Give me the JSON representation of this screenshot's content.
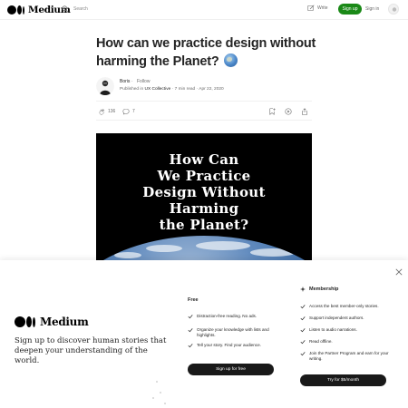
{
  "topbar": {
    "logo_text": "Medium",
    "search_placeholder": "Search",
    "write_label": "Write",
    "signup_label": "Sign up",
    "signin_label": "Sign in"
  },
  "article": {
    "title": "How can we practice design without harming the Planet?",
    "author": {
      "name": "Boris",
      "separator": "·",
      "follow": "Follow",
      "published_in_prefix": "Published in",
      "publication": "UX Collective",
      "read_time": "7 min read",
      "date": "Apr 22, 2020"
    },
    "claps": "136",
    "responses": "7",
    "hero_text_lines": [
      "How Can",
      "We Practice",
      "Design Without",
      "Harming",
      "the Planet?"
    ]
  },
  "modal": {
    "logo_text": "Medium",
    "tagline": "Sign up to discover human stories that deepen your understanding of the world.",
    "free": {
      "title": "Free",
      "items": [
        "Distraction-free reading. No ads.",
        "Organize your knowledge with lists and highlights.",
        "Tell your story. Find your audience."
      ],
      "cta": "Sign up for free"
    },
    "membership": {
      "title": "Membership",
      "items": [
        "Access the best member-only stories.",
        "Support independent authors.",
        "Listen to audio narrations.",
        "Read offline.",
        "Join the Partner Program and earn for your writing."
      ],
      "cta": "Try for $5/month"
    }
  },
  "colors": {
    "brand_green": "#1a8917",
    "text_primary": "#242424",
    "text_secondary": "#6b6b6b",
    "cta_dark": "#191919"
  },
  "icons": [
    "search-icon",
    "write-icon",
    "clap-icon",
    "comment-icon",
    "bookmark-add-icon",
    "play-icon",
    "share-icon",
    "close-icon",
    "check-icon",
    "sparkle-icon"
  ]
}
